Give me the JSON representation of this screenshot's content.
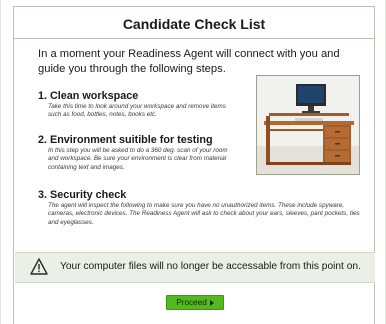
{
  "dialog": {
    "title": "Candidate Check List",
    "intro": "In a moment your Readiness Agent will connect with you and guide you through the following steps."
  },
  "steps": [
    {
      "title": "1. Clean workspace",
      "description": "Take this time to look around your workspace and remove items such as food, bottles, notes, books etc."
    },
    {
      "title": "2. Environment suitible for testing",
      "description": "In this step you will be asked to do a 360 deg. scan of your room and workspace. Be sure your environment is clear from material containing text and images."
    },
    {
      "title": "3. Security check",
      "description": "The agent will inspect the following to make sure you have no unauthorized items. These include spyware, cameras, electronic devices. The Readiness Agent will ask to check about your ears, sleeves, pant pockets, ties and eyeglasses."
    }
  ],
  "warning": {
    "text": "Your computer files will no longer be accessable from this point on.",
    "icon": "warning-triangle-icon"
  },
  "proceed": {
    "label": "Proceed",
    "icon": "play-arrow-icon"
  },
  "colors": {
    "panel_border": "#b8c4b2",
    "warning_bg": "#eaf0e5",
    "button_bg": "#54b91d"
  }
}
